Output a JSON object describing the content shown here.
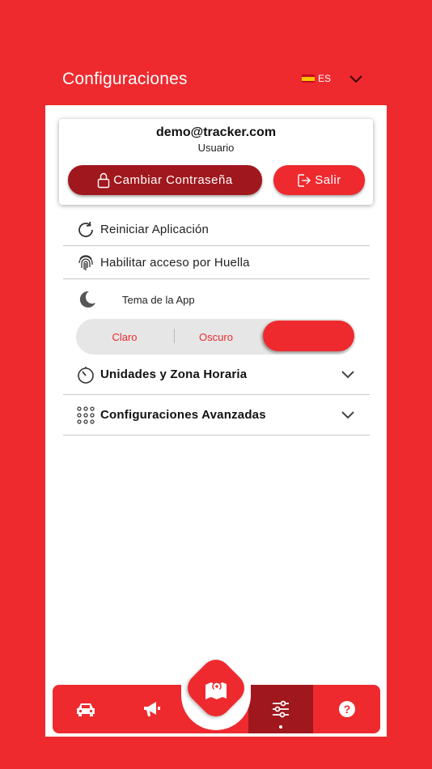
{
  "header": {
    "title": "Configuraciones",
    "language_code": "ES",
    "language_flag": "spain-flag-icon"
  },
  "user": {
    "email": "demo@tracker.com",
    "role": "Usuario",
    "change_password_label": "Cambiar Contraseña",
    "logout_label": "Salir"
  },
  "settings": {
    "restart_label": "Reiniciar Aplicación",
    "fingerprint_label": "Habilitar acceso por Huella",
    "theme_label": "Tema de la App",
    "theme_options": [
      "Claro",
      "Oscuro",
      ""
    ],
    "units_label": "Unidades y Zona Horaria",
    "advanced_label": "Configuraciones Avanzadas"
  },
  "tabbar": {
    "items": [
      "car-icon",
      "megaphone-icon",
      "map-icon",
      "sliders-icon",
      "help-icon"
    ],
    "active": "sliders-icon"
  },
  "colors": {
    "brand_red": "#ee2a2f",
    "dark_red": "#a0181d"
  }
}
